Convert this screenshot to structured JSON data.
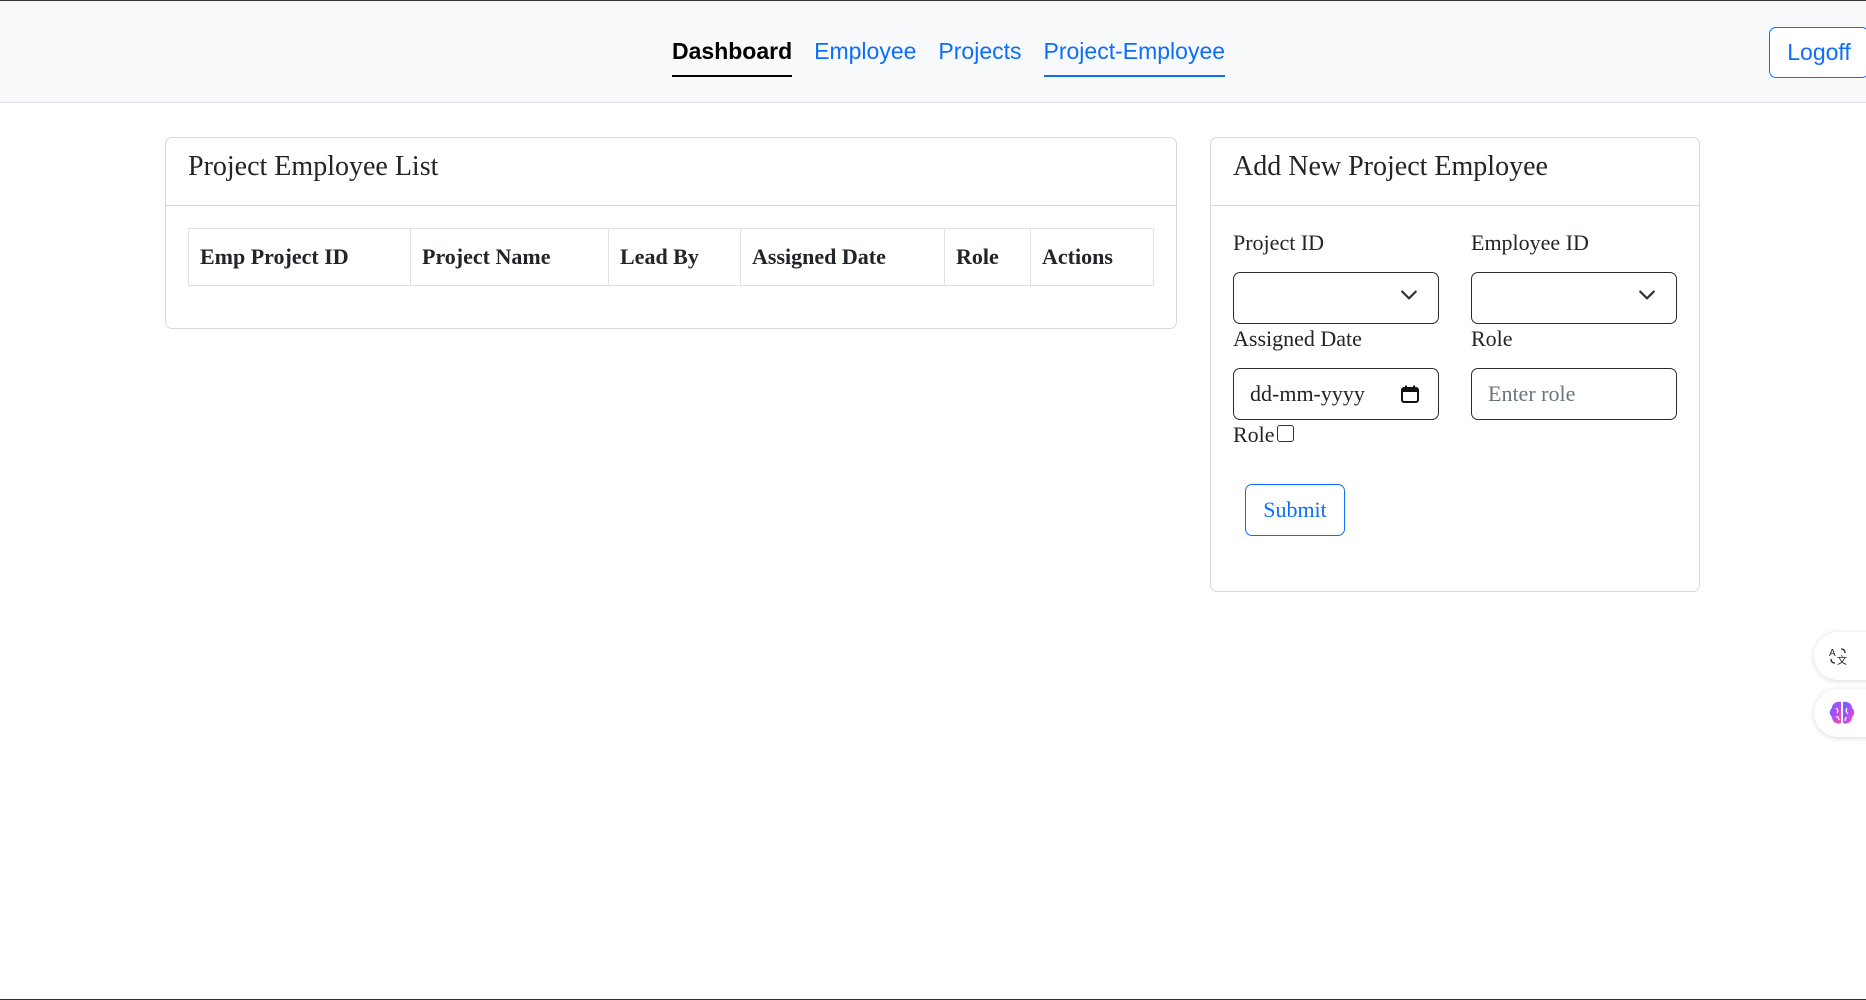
{
  "navbar": {
    "links": [
      {
        "label": "Dashboard"
      },
      {
        "label": "Employee"
      },
      {
        "label": "Projects"
      },
      {
        "label": "Project-Employee"
      }
    ],
    "logoff_label": "Logoff"
  },
  "list_card": {
    "title": "Project Employee List",
    "columns": [
      "Emp Project ID",
      "Project Name",
      "Lead By",
      "Assigned Date",
      "Role",
      "Actions"
    ]
  },
  "form_card": {
    "title": "Add New Project Employee",
    "project_id_label": "Project ID",
    "project_id_value": "",
    "employee_id_label": "Employee ID",
    "employee_id_value": "",
    "assigned_date_label": "Assigned Date",
    "assigned_date_placeholder": "dd-mm-yyyy",
    "role_label": "Role",
    "role_placeholder": "Enter role",
    "role_checkbox_label": "Role",
    "submit_label": "Submit"
  },
  "side_widgets": [
    {
      "icon": "translate-icon"
    },
    {
      "icon": "brain-icon"
    }
  ],
  "colors": {
    "accent": "#0d6efd",
    "navbar_bg": "#f8f9fa"
  }
}
